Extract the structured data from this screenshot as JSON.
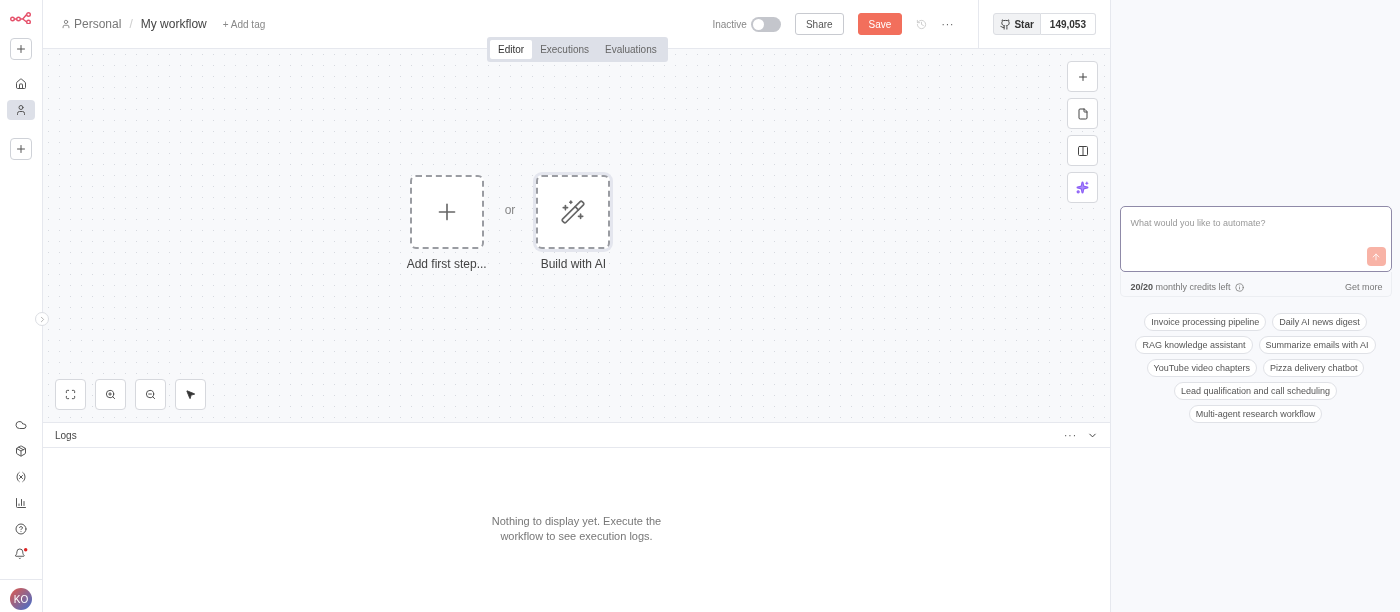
{
  "sidebar": {
    "avatar": "KO"
  },
  "header": {
    "owner": "Personal",
    "separator": "/",
    "workflow_name": "My workflow",
    "add_tag": "+ Add tag",
    "status": {
      "label": "Inactive",
      "on": false
    },
    "share": "Share",
    "save": "Save",
    "more": "···",
    "github": {
      "label": "Star",
      "count": "149,053"
    }
  },
  "tabs": [
    {
      "label": "Editor",
      "selected": true
    },
    {
      "label": "Executions",
      "selected": false
    },
    {
      "label": "Evaluations",
      "selected": false
    }
  ],
  "canvas": {
    "add_first_step": "Add first step...",
    "or": "or",
    "build_with_ai": "Build with AI"
  },
  "logs": {
    "title": "Logs",
    "more": "···",
    "empty": "Nothing to display yet. Execute the workflow to see execution logs."
  },
  "assistant": {
    "placeholder": "What would you like to automate?",
    "credits": "**20/20** monthly credits left",
    "get_more": "Get more",
    "suggestions": [
      "Invoice processing pipeline",
      "Daily AI news digest",
      "RAG knowledge assistant",
      "Summarize emails with AI",
      "YouTube video chapters",
      "Pizza delivery chatbot",
      "Lead qualification and call scheduling",
      "Multi-agent research workflow"
    ]
  }
}
